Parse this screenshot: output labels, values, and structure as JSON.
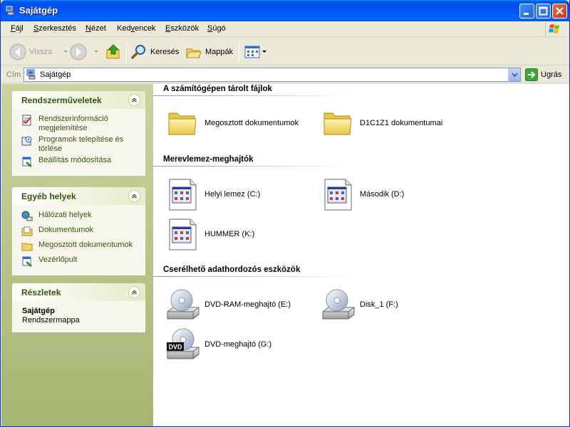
{
  "window": {
    "title": "Sajátgép"
  },
  "menu": [
    {
      "label": "Fájl",
      "u": "F",
      "rest": "ájl"
    },
    {
      "label": "Szerkesztés",
      "u": "S",
      "rest": "zerkesztés"
    },
    {
      "label": "Nézet",
      "u": "N",
      "rest": "ézet"
    },
    {
      "label": "Kedvencek",
      "pre": "Ked",
      "u": "v",
      "rest": "encek"
    },
    {
      "label": "Eszközök",
      "u": "E",
      "rest": "szközök"
    },
    {
      "label": "Súgó",
      "u": "S",
      "rest": "úgó"
    }
  ],
  "toolbar": {
    "back_label": "Vissza",
    "search_label": "Keresés",
    "folders_label": "Mappák"
  },
  "address": {
    "label": "Cím",
    "value": "Sajátgép",
    "go_label": "Ugrás"
  },
  "sidebar": {
    "system_tasks": {
      "title": "Rendszerműveletek",
      "items": [
        {
          "label": "Rendszerinformáció megjelenítése",
          "icon": "system-info-icon"
        },
        {
          "label": "Programok telepítése és törlése",
          "icon": "add-remove-programs-icon"
        },
        {
          "label": "Beállítás módosítása",
          "icon": "control-panel-settings-icon"
        }
      ]
    },
    "other_places": {
      "title": "Egyéb helyek",
      "items": [
        {
          "label": "Hálózati helyek",
          "icon": "network-places-icon"
        },
        {
          "label": "Dokumentumok",
          "icon": "documents-icon"
        },
        {
          "label": "Megosztott dokumentumok",
          "icon": "shared-documents-icon"
        },
        {
          "label": "Vezérlőpult",
          "icon": "control-panel-icon"
        }
      ]
    },
    "details": {
      "title": "Részletek",
      "name": "Sajátgép",
      "type": "Rendszermappa"
    }
  },
  "content": {
    "groups": [
      {
        "title": "A számítógépen tárolt fájlok",
        "items": [
          {
            "label": "Megosztott dokumentumok",
            "icon": "folder-icon"
          },
          {
            "label": "D1C1Z1 dokumentumai",
            "icon": "folder-icon"
          }
        ]
      },
      {
        "title": "Merevlemez-meghajtók",
        "items": [
          {
            "label": "Helyi lemez (C:)",
            "icon": "hard-drive-icon"
          },
          {
            "label": "Második (D:)",
            "icon": "hard-drive-icon"
          },
          {
            "label": "HUMMER (K:)",
            "icon": "hard-drive-icon"
          }
        ]
      },
      {
        "title": "Cserélhető adathordozós eszközök",
        "items": [
          {
            "label": "DVD-RAM-meghajtó (E:)",
            "icon": "cd-drive-icon"
          },
          {
            "label": "Disk_1 (F:)",
            "icon": "cd-drive-icon"
          },
          {
            "label": "DVD-meghajtó (G:)",
            "icon": "dvd-drive-icon",
            "badge": "DVD"
          }
        ]
      }
    ]
  },
  "colors": {
    "titlebar": "#0053ee",
    "sidebar_link": "#37580c",
    "content_bg": "#ffffff"
  }
}
